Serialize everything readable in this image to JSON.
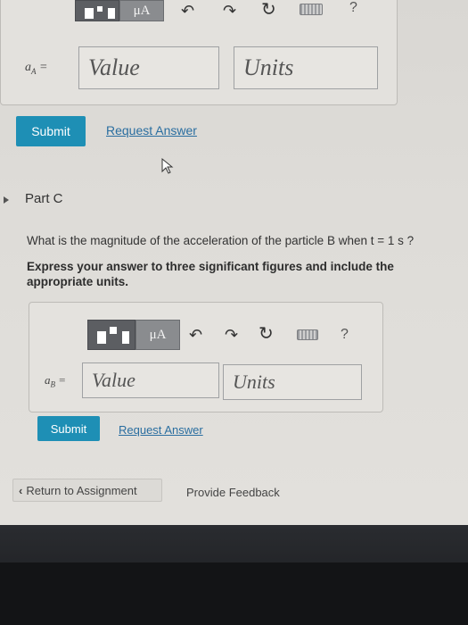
{
  "part_b": {
    "variable_label": "a_A =",
    "value_placeholder": "Value",
    "units_placeholder": "Units",
    "submit_label": "Submit",
    "request_answer_label": "Request Answer",
    "toolbar_mu": "μA",
    "toolbar_help": "?"
  },
  "part_c": {
    "title": "Part C",
    "question": "What is the magnitude of the acceleration of the particle B when t = 1 s ?",
    "instructions": "Express your answer to three significant figures and include the appropriate units.",
    "variable_label": "a_B =",
    "value_placeholder": "Value",
    "units_placeholder": "Units",
    "submit_label": "Submit",
    "request_answer_label": "Request Answer",
    "toolbar_mu": "μA",
    "toolbar_help": "?"
  },
  "footer": {
    "return_label": "Return to Assignment",
    "feedback_label": "Provide Feedback"
  },
  "colors": {
    "submit": "#1e8fb5",
    "link": "#2a6ea0"
  },
  "icons": [
    "templates-icon",
    "mu-units-icon",
    "undo-icon",
    "redo-icon",
    "reset-icon",
    "keyboard-icon",
    "help-icon",
    "chevron-left-icon",
    "cursor-icon",
    "collapse-arrow-icon"
  ]
}
